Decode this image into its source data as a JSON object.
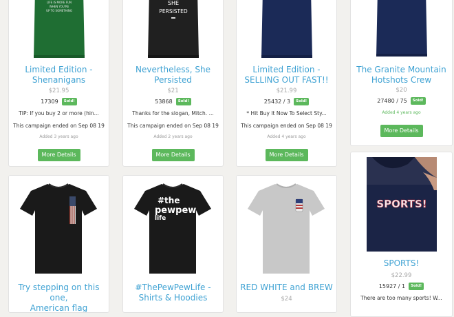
{
  "products": [
    {
      "title_line1": "Limited Edition -",
      "title_line2": "Shenanigans",
      "price": "$21.95",
      "sales": "17309",
      "badge": "Sold!",
      "description": "TIP: If you buy 2 or more (hin...",
      "ended": "This campaign ended on Sep 08 19",
      "added": "Added 3 years ago",
      "button": "More Details",
      "shirt_color": "#1f6e33",
      "shirt_text_lines": [
        "LIFE IS MORE FUN",
        "WHEN YOU'RE",
        "UP TO SOMETHING"
      ]
    },
    {
      "title_line1": "Nevertheless, She",
      "title_line2": "Persisted",
      "price": "$21",
      "sales": "53868",
      "badge": "Sold!",
      "description": "Thanks for the slogan, Mitch. ...",
      "ended": "This campaign ended on Sep 08 19",
      "added": "Added 2 years ago",
      "button": "More Details",
      "shirt_color": "#202020",
      "shirt_text_lines": [
        "SHE",
        "PERSISTED"
      ]
    },
    {
      "title_line1": "Limited Edition -",
      "title_line2": "SELLING OUT FAST!!",
      "price": "$21.99",
      "sales": "25432 / 3",
      "badge": "Sold!",
      "description": "* Hit Buy It Now To Select Sty...",
      "ended": "This campaign ended on Sep 08 19",
      "added": "Added 4 years ago",
      "button": "More Details",
      "shirt_color": "#1b2a57"
    },
    {
      "title_line1": "The Granite Mountain",
      "title_line2": "Hotshots Crew",
      "price": "$20",
      "sales": "27480 / 75",
      "badge": "Sold!",
      "added": "Added 4 years ago",
      "button": "More Details",
      "shirt_color": "#1b2a57"
    },
    {
      "title_line1": "Try stepping on this one,",
      "title_line2": "American flag",
      "shirt_color": "#1a1a1a"
    },
    {
      "title_line1": "#ThePewPewLife -",
      "title_line2": "Shirts & Hoodies",
      "shirt_color": "#1a1a1a",
      "shirt_text_lines": [
        "#the",
        "pewpew",
        "life"
      ]
    },
    {
      "title_line1": "RED WHITE and BREW",
      "price": "$24",
      "shirt_color": "#c8c8c8"
    },
    {
      "title_line1": "SPORTS!",
      "price": "$22.99",
      "sales": "15927 / 1",
      "badge": "Sold!",
      "description": "There are too many sports!  W...",
      "shirt_color": "#1b2446",
      "shirt_text": "SPORTS!"
    }
  ]
}
